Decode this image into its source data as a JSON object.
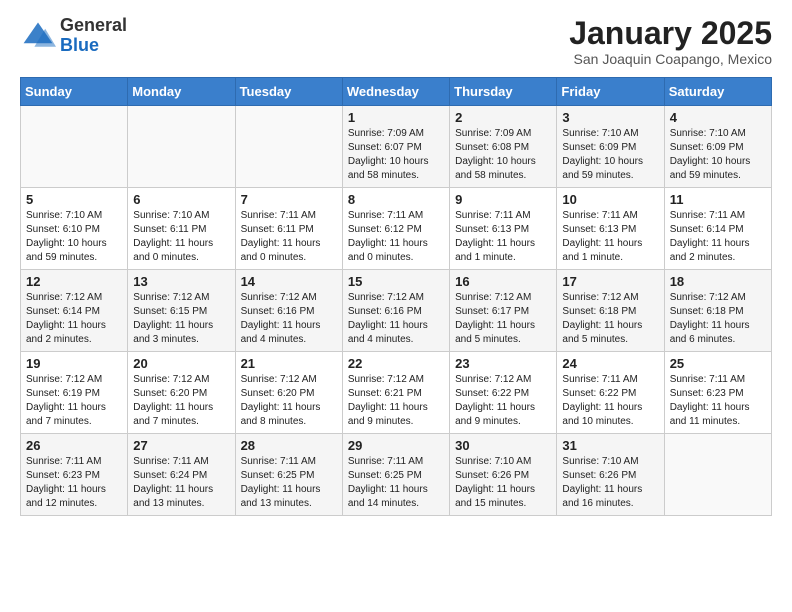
{
  "logo": {
    "general": "General",
    "blue": "Blue"
  },
  "header": {
    "month": "January 2025",
    "location": "San Joaquin Coapango, Mexico"
  },
  "weekdays": [
    "Sunday",
    "Monday",
    "Tuesday",
    "Wednesday",
    "Thursday",
    "Friday",
    "Saturday"
  ],
  "weeks": [
    [
      {
        "day": "",
        "info": ""
      },
      {
        "day": "",
        "info": ""
      },
      {
        "day": "",
        "info": ""
      },
      {
        "day": "1",
        "info": "Sunrise: 7:09 AM\nSunset: 6:07 PM\nDaylight: 10 hours\nand 58 minutes."
      },
      {
        "day": "2",
        "info": "Sunrise: 7:09 AM\nSunset: 6:08 PM\nDaylight: 10 hours\nand 58 minutes."
      },
      {
        "day": "3",
        "info": "Sunrise: 7:10 AM\nSunset: 6:09 PM\nDaylight: 10 hours\nand 59 minutes."
      },
      {
        "day": "4",
        "info": "Sunrise: 7:10 AM\nSunset: 6:09 PM\nDaylight: 10 hours\nand 59 minutes."
      }
    ],
    [
      {
        "day": "5",
        "info": "Sunrise: 7:10 AM\nSunset: 6:10 PM\nDaylight: 10 hours\nand 59 minutes."
      },
      {
        "day": "6",
        "info": "Sunrise: 7:10 AM\nSunset: 6:11 PM\nDaylight: 11 hours\nand 0 minutes."
      },
      {
        "day": "7",
        "info": "Sunrise: 7:11 AM\nSunset: 6:11 PM\nDaylight: 11 hours\nand 0 minutes."
      },
      {
        "day": "8",
        "info": "Sunrise: 7:11 AM\nSunset: 6:12 PM\nDaylight: 11 hours\nand 0 minutes."
      },
      {
        "day": "9",
        "info": "Sunrise: 7:11 AM\nSunset: 6:13 PM\nDaylight: 11 hours\nand 1 minute."
      },
      {
        "day": "10",
        "info": "Sunrise: 7:11 AM\nSunset: 6:13 PM\nDaylight: 11 hours\nand 1 minute."
      },
      {
        "day": "11",
        "info": "Sunrise: 7:11 AM\nSunset: 6:14 PM\nDaylight: 11 hours\nand 2 minutes."
      }
    ],
    [
      {
        "day": "12",
        "info": "Sunrise: 7:12 AM\nSunset: 6:14 PM\nDaylight: 11 hours\nand 2 minutes."
      },
      {
        "day": "13",
        "info": "Sunrise: 7:12 AM\nSunset: 6:15 PM\nDaylight: 11 hours\nand 3 minutes."
      },
      {
        "day": "14",
        "info": "Sunrise: 7:12 AM\nSunset: 6:16 PM\nDaylight: 11 hours\nand 4 minutes."
      },
      {
        "day": "15",
        "info": "Sunrise: 7:12 AM\nSunset: 6:16 PM\nDaylight: 11 hours\nand 4 minutes."
      },
      {
        "day": "16",
        "info": "Sunrise: 7:12 AM\nSunset: 6:17 PM\nDaylight: 11 hours\nand 5 minutes."
      },
      {
        "day": "17",
        "info": "Sunrise: 7:12 AM\nSunset: 6:18 PM\nDaylight: 11 hours\nand 5 minutes."
      },
      {
        "day": "18",
        "info": "Sunrise: 7:12 AM\nSunset: 6:18 PM\nDaylight: 11 hours\nand 6 minutes."
      }
    ],
    [
      {
        "day": "19",
        "info": "Sunrise: 7:12 AM\nSunset: 6:19 PM\nDaylight: 11 hours\nand 7 minutes."
      },
      {
        "day": "20",
        "info": "Sunrise: 7:12 AM\nSunset: 6:20 PM\nDaylight: 11 hours\nand 7 minutes."
      },
      {
        "day": "21",
        "info": "Sunrise: 7:12 AM\nSunset: 6:20 PM\nDaylight: 11 hours\nand 8 minutes."
      },
      {
        "day": "22",
        "info": "Sunrise: 7:12 AM\nSunset: 6:21 PM\nDaylight: 11 hours\nand 9 minutes."
      },
      {
        "day": "23",
        "info": "Sunrise: 7:12 AM\nSunset: 6:22 PM\nDaylight: 11 hours\nand 9 minutes."
      },
      {
        "day": "24",
        "info": "Sunrise: 7:11 AM\nSunset: 6:22 PM\nDaylight: 11 hours\nand 10 minutes."
      },
      {
        "day": "25",
        "info": "Sunrise: 7:11 AM\nSunset: 6:23 PM\nDaylight: 11 hours\nand 11 minutes."
      }
    ],
    [
      {
        "day": "26",
        "info": "Sunrise: 7:11 AM\nSunset: 6:23 PM\nDaylight: 11 hours\nand 12 minutes."
      },
      {
        "day": "27",
        "info": "Sunrise: 7:11 AM\nSunset: 6:24 PM\nDaylight: 11 hours\nand 13 minutes."
      },
      {
        "day": "28",
        "info": "Sunrise: 7:11 AM\nSunset: 6:25 PM\nDaylight: 11 hours\nand 13 minutes."
      },
      {
        "day": "29",
        "info": "Sunrise: 7:11 AM\nSunset: 6:25 PM\nDaylight: 11 hours\nand 14 minutes."
      },
      {
        "day": "30",
        "info": "Sunrise: 7:10 AM\nSunset: 6:26 PM\nDaylight: 11 hours\nand 15 minutes."
      },
      {
        "day": "31",
        "info": "Sunrise: 7:10 AM\nSunset: 6:26 PM\nDaylight: 11 hours\nand 16 minutes."
      },
      {
        "day": "",
        "info": ""
      }
    ]
  ]
}
